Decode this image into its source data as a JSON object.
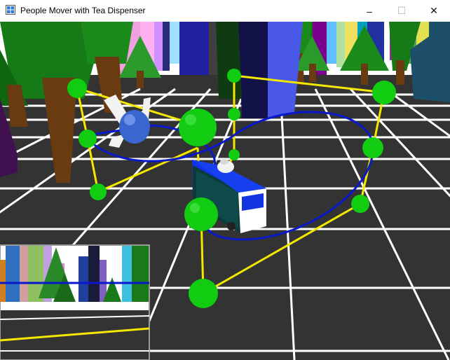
{
  "window": {
    "title": "People Mover with Tea Dispenser",
    "controls": {
      "minimize": "–",
      "maximize": "☐",
      "close": "✕"
    }
  },
  "scene": {
    "sky_color": "#ffffff",
    "ground_color": "#333333",
    "grid_color": "#ffffff",
    "track_color": "#0a18cc",
    "rail_color": "#f5e800",
    "node_color": "#11cc11",
    "vehicle_color": "#1234e0",
    "propeller_hub_color": "#3a66d0"
  },
  "minimap": {
    "border_color": "#9a9a9a"
  }
}
